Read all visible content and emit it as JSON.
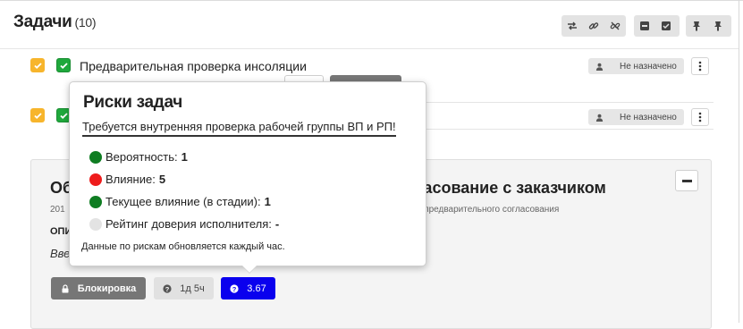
{
  "header": {
    "title": "Задачи",
    "count": "(10)"
  },
  "rows": [
    {
      "text": "Предварительная проверка инсоляции",
      "assignee": "Не назначено"
    },
    {
      "text": "",
      "assignee": "Не назначено"
    }
  ],
  "popover": {
    "title": "Риски задач",
    "subtitle": "Требуется внутренняя проверка рабочей группы ВП и РП!",
    "metrics": [
      {
        "label": "Вероятность:",
        "value": "1",
        "color": "#0f7d22"
      },
      {
        "label": "Влияние:",
        "value": "5",
        "color": "#ee1c1c"
      },
      {
        "label": "Текущее влияние (в стадии):",
        "value": "1",
        "color": "#0f7d22"
      },
      {
        "label": "Рейтинг доверия исполнителя:",
        "value": "-",
        "color": "#e3e3e3"
      }
    ],
    "note": "Данные по рискам обновляется каждый час."
  },
  "card": {
    "title_left": "Об",
    "title_right": "ласование с заказчиком",
    "sub_left": "201",
    "sub_right": "я предварительного согласования",
    "label": "ОПИ",
    "italic": "Вве"
  },
  "badges": {
    "lock": "Блокировка",
    "time": "1д 5ч",
    "score": "3.67"
  },
  "colors": {
    "score_badge": "#0a00ee",
    "check_yellow": "#f7b52c",
    "check_green": "#1fa83c"
  }
}
